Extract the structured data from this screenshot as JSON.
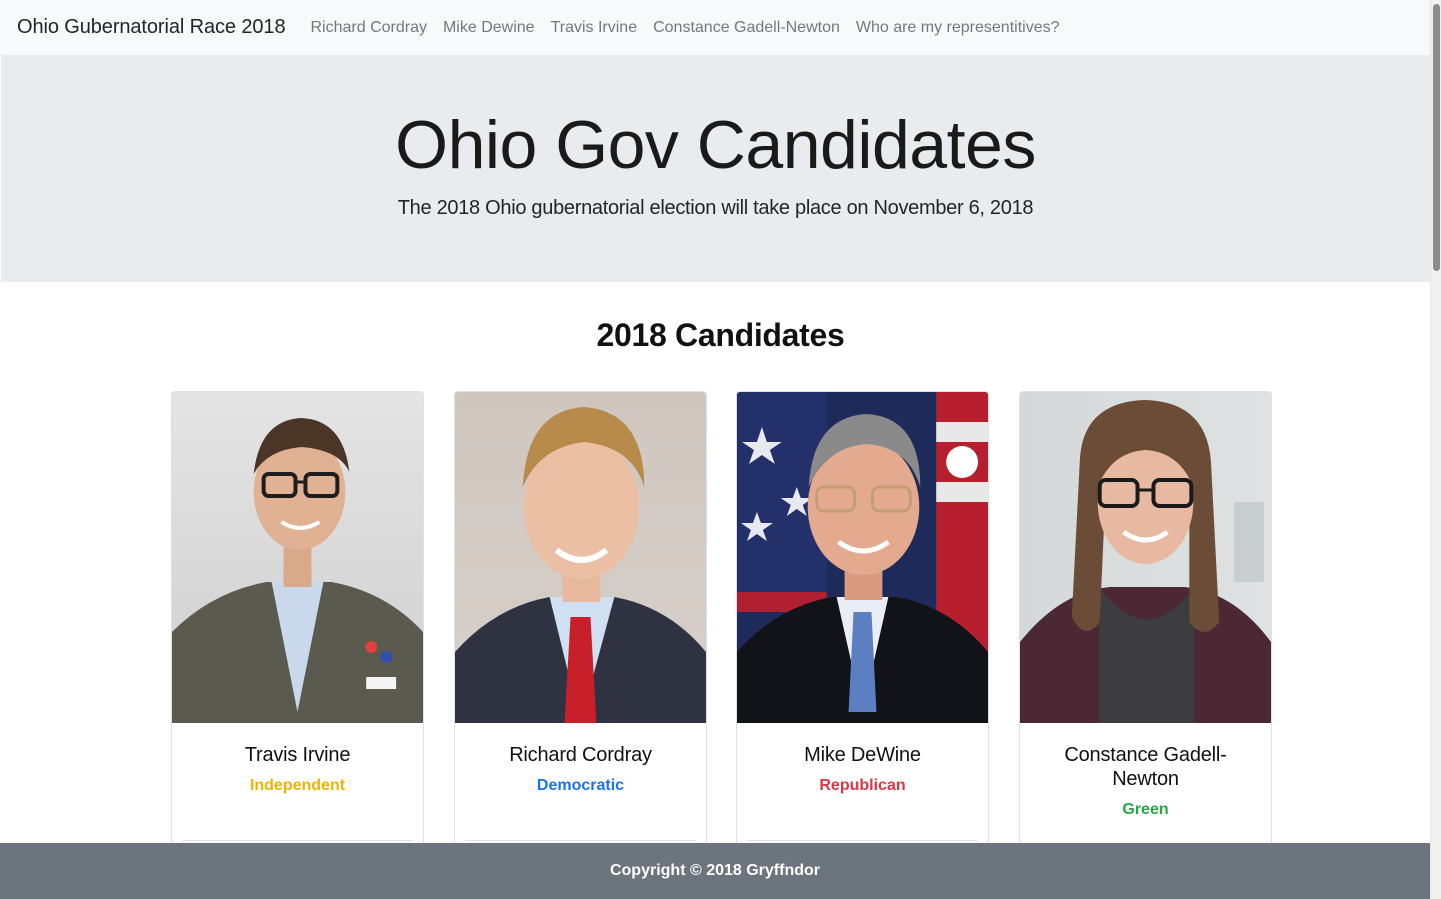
{
  "navbar": {
    "brand": "Ohio Gubernatorial Race 2018",
    "links": [
      {
        "label": "Richard Cordray"
      },
      {
        "label": "Mike Dewine"
      },
      {
        "label": "Travis Irvine"
      },
      {
        "label": "Constance Gadell-Newton"
      },
      {
        "label": "Who are my representitives?"
      }
    ]
  },
  "jumbotron": {
    "title": "Ohio Gov Candidates",
    "lead": "The 2018 Ohio gubernatorial election will take place on November 6, 2018"
  },
  "section": {
    "title": "2018 Candidates"
  },
  "candidates": [
    {
      "name": "Travis Irvine",
      "party": "Independent",
      "party_color": "#f0b400"
    },
    {
      "name": "Richard Cordray",
      "party": "Democratic",
      "party_color": "#1a73e8"
    },
    {
      "name": "Mike DeWine",
      "party": "Republican",
      "party_color": "#dc3545"
    },
    {
      "name": "Constance Gadell-Newton",
      "party": "Green",
      "party_color": "#28a745"
    }
  ],
  "footer": {
    "text": "Copyright © 2018 Gryffndor"
  },
  "colors": {
    "navbar_bg": "#f8f9fa",
    "jumbotron_bg": "#e9ecef",
    "footer_bg": "#6c757d"
  }
}
